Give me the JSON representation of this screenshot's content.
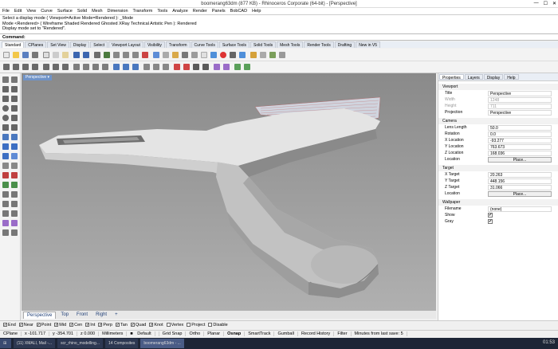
{
  "window": {
    "title": "boomerang63dm (877 KB) - Rhinoceros Corporate (64-bit) - [Perspective]"
  },
  "menu": [
    "File",
    "Edit",
    "View",
    "Curve",
    "Surface",
    "Solid",
    "Mesh",
    "Dimension",
    "Transform",
    "Tools",
    "Analyze",
    "Render",
    "Panels",
    "BobCAD",
    "Help"
  ],
  "history": [
    "Select a display mode ( Viewport=Active  Mode=Rendered ): _Mode",
    "Mode <Rendered> ( Wireframe  Shaded  Rendered  Ghosted  XRay  Technical  Artistic  Pen ): Rendered",
    "Display mode set to \"Rendered\"."
  ],
  "command": {
    "label": "Command:"
  },
  "toolbar_tabs": [
    "Standard",
    "CPlanes",
    "Set View",
    "Display",
    "Select",
    "Viewport Layout",
    "Visibility",
    "Transform",
    "Curve Tools",
    "Surface Tools",
    "Solid Tools",
    "Mesh Tools",
    "Render Tools",
    "Drafting",
    "New in V5"
  ],
  "viewport": {
    "label": "Perspective"
  },
  "viewport_tabs": [
    "Perspective",
    "Top",
    "Front",
    "Right",
    "+"
  ],
  "panel": {
    "tabs": [
      "Properties",
      "Layers",
      "Display",
      "Help"
    ],
    "sections": {
      "viewport": "Viewport",
      "camera": "Camera",
      "target": "Target",
      "wallpaper": "Wallpaper"
    },
    "viewport_rows": [
      {
        "label": "Title",
        "value": "Perspective"
      },
      {
        "label": "Width",
        "value": "1248"
      },
      {
        "label": "Height",
        "value": "711"
      },
      {
        "label": "Projection",
        "value": "Perspective"
      }
    ],
    "camera_rows": [
      {
        "label": "Lens Length",
        "value": "50.0"
      },
      {
        "label": "Rotation",
        "value": "0.0"
      },
      {
        "label": "X Location",
        "value": "-93.277"
      },
      {
        "label": "Y Location",
        "value": "763.673"
      },
      {
        "label": "Z Location",
        "value": "168.036"
      }
    ],
    "camera_location": {
      "label": "Location",
      "button": "Place..."
    },
    "target_rows": [
      {
        "label": "X Target",
        "value": "20.263"
      },
      {
        "label": "Y Target",
        "value": "448.156"
      },
      {
        "label": "Z Target",
        "value": "31.066"
      }
    ],
    "target_location": {
      "label": "Location",
      "button": "Place..."
    },
    "wallpaper_rows": [
      {
        "label": "Filename",
        "value": "(none)"
      },
      {
        "label": "Show",
        "value": "✔"
      },
      {
        "label": "Gray",
        "value": "✔"
      }
    ]
  },
  "osnaps": [
    {
      "label": "End",
      "checked": true
    },
    {
      "label": "Near",
      "checked": true
    },
    {
      "label": "Point",
      "checked": true
    },
    {
      "label": "Mid",
      "checked": true
    },
    {
      "label": "Cen",
      "checked": true
    },
    {
      "label": "Int",
      "checked": true
    },
    {
      "label": "Perp",
      "checked": true
    },
    {
      "label": "Tan",
      "checked": true
    },
    {
      "label": "Quad",
      "checked": true
    },
    {
      "label": "Knot",
      "checked": true
    },
    {
      "label": "Vertex",
      "checked": false
    },
    {
      "label": "Project",
      "checked": false
    },
    {
      "label": "Disable",
      "checked": false
    }
  ],
  "status": [
    "CPlane",
    "x -101.717",
    "y -354.701",
    "z 0.000",
    "Millimeters",
    "Default",
    "Grid Snap",
    "Ortho",
    "Planar",
    "Osnap",
    "SmartTrack",
    "Gumball",
    "Record History",
    "Filter",
    "Minutes from last save: 5"
  ],
  "taskbar": [
    "(11) XMALI, Mail -...",
    "scr_rhino_modelling...",
    "14 Composites",
    "boomerang63dm - ..."
  ],
  "clock": "01:53",
  "colors": {
    "viewport_bg": "#9a9a9a",
    "model": "#c8c8c8",
    "accent": "#6f93c8",
    "taskbar": "#1d2536"
  }
}
